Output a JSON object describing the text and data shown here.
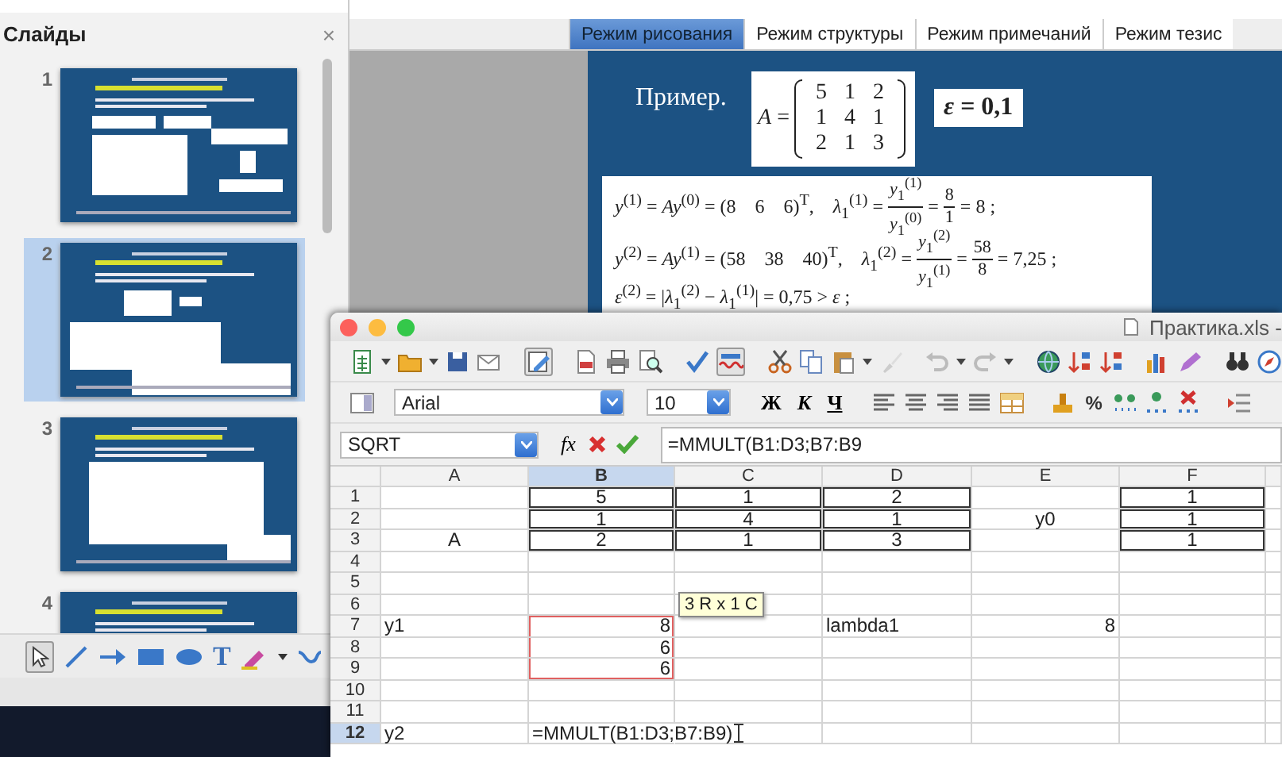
{
  "slides_panel": {
    "title": "Слайды",
    "close": "×",
    "slides": [
      {
        "number": "1",
        "selected": false
      },
      {
        "number": "2",
        "selected": true
      },
      {
        "number": "3",
        "selected": false
      },
      {
        "number": "4",
        "selected": false
      }
    ]
  },
  "drawing_toolbar": {
    "text_tool": "T"
  },
  "view_tabs": [
    {
      "label": "Режим рисования",
      "selected": true
    },
    {
      "label": "Режим структуры",
      "selected": false
    },
    {
      "label": "Режим примечаний",
      "selected": false
    },
    {
      "label": "Режим тезис",
      "selected": false
    }
  ],
  "slide": {
    "example_label": "Пример.",
    "matrix": {
      "label": "*A* =",
      "rows": [
        [
          "5",
          "1",
          "2"
        ],
        [
          "1",
          "4",
          "1"
        ],
        [
          "2",
          "1",
          "3"
        ]
      ]
    },
    "epsilon": "*ε* = 0,1",
    "formula_lines": [
      [
        {
          "kind": "text",
          "text": "*y*$^{(1)}$ = *Ay*$^{(0)}$ = (8    6    6)$^{T}$,    *λ*$_{1}$$^{(1)}$ = "
        },
        {
          "kind": "frac",
          "num": "*y*$_{1}$$^{(1)}$",
          "den": "*y*$_{1}$$^{(0)}$"
        },
        {
          "kind": "text",
          "text": " = "
        },
        {
          "kind": "frac",
          "num": "8",
          "den": "1"
        },
        {
          "kind": "text",
          "text": " = 8 ;"
        }
      ],
      [
        {
          "kind": "text",
          "text": "*y*$^{(2)}$ = *Ay*$^{(1)}$ = (58    38    40)$^{T}$,    *λ*$_{1}$$^{(2)}$ = "
        },
        {
          "kind": "frac",
          "num": "*y*$_{1}$$^{(2)}$",
          "den": "*y*$_{1}$$^{(1)}$"
        },
        {
          "kind": "text",
          "text": " = "
        },
        {
          "kind": "frac",
          "num": "58",
          "den": "8"
        },
        {
          "kind": "text",
          "text": " = 7,25 ;"
        }
      ],
      [
        {
          "kind": "text",
          "text": "*ε*$^{(2)}$ = |*λ*$_{1}$$^{(2)}$ − *λ*$_{1}$$^{(1)}$| = 0,75 > *ε* ;"
        }
      ]
    ]
  },
  "calc": {
    "title": "Практика.xls -",
    "font_name": "Arial",
    "font_size": "10",
    "format_buttons": [
      "Ж",
      "К",
      "Ч"
    ],
    "percent": "%",
    "name_box": "SQRT",
    "function_button": "fx",
    "formula": "=MMULT(B1:D3;B7:B9",
    "columns": [
      {
        "label": "A",
        "selected": false
      },
      {
        "label": "B",
        "selected": true
      },
      {
        "label": "C",
        "selected": false
      },
      {
        "label": "D",
        "selected": false
      },
      {
        "label": "E",
        "selected": false
      },
      {
        "label": "F",
        "selected": false
      }
    ],
    "rows": [
      {
        "header": "1",
        "selected": false,
        "cells": [
          null,
          {
            "text": "5",
            "kind": "centered",
            "selected": false,
            "boxed": true
          },
          {
            "text": "1",
            "kind": "centered",
            "selected": false,
            "boxed": true
          },
          {
            "text": "2",
            "kind": "centered",
            "selected": false,
            "boxed": true
          },
          null,
          {
            "text": "1",
            "kind": "centered",
            "selected": false,
            "boxed": true
          }
        ]
      },
      {
        "header": "2",
        "selected": false,
        "cells": [
          null,
          {
            "text": "1",
            "kind": "centered",
            "selected": false,
            "boxed": true
          },
          {
            "text": "4",
            "kind": "centered",
            "selected": false,
            "boxed": true
          },
          {
            "text": "1",
            "kind": "centered",
            "selected": false,
            "boxed": true
          },
          {
            "text": "y0",
            "kind": "centered",
            "selected": false,
            "boxed": false
          },
          {
            "text": "1",
            "kind": "centered",
            "selected": false,
            "boxed": true
          }
        ]
      },
      {
        "header": "3",
        "selected": false,
        "cells": [
          {
            "text": "A",
            "kind": "centered",
            "selected": false,
            "boxed": false
          },
          {
            "text": "2",
            "kind": "centered",
            "selected": false,
            "boxed": true
          },
          {
            "text": "1",
            "kind": "centered",
            "selected": false,
            "boxed": true
          },
          {
            "text": "3",
            "kind": "centered",
            "selected": false,
            "boxed": true
          },
          null,
          {
            "text": "1",
            "kind": "centered",
            "selected": false,
            "boxed": true
          }
        ]
      },
      {
        "header": "4",
        "selected": false,
        "cells": []
      },
      {
        "header": "5",
        "selected": false,
        "cells": []
      },
      {
        "header": "6",
        "selected": false,
        "cells": []
      },
      {
        "header": "7",
        "selected": false,
        "cells": [
          {
            "text": "y1",
            "kind": "text",
            "selected": false,
            "boxed": false
          },
          {
            "text": "8",
            "kind": "number",
            "selected": true,
            "boxed": false
          },
          null,
          {
            "text": "lambda1",
            "kind": "text",
            "selected": false,
            "boxed": false
          },
          {
            "text": "8",
            "kind": "number",
            "selected": false,
            "boxed": false
          },
          null
        ]
      },
      {
        "header": "8",
        "selected": false,
        "cells": [
          null,
          {
            "text": "6",
            "kind": "number",
            "selected": true,
            "boxed": false
          }
        ]
      },
      {
        "header": "9",
        "selected": false,
        "cells": [
          null,
          {
            "text": "6",
            "kind": "number",
            "selected": true,
            "boxed": false
          }
        ]
      },
      {
        "header": "10",
        "selected": false,
        "cells": []
      },
      {
        "header": "11",
        "selected": false,
        "cells": []
      },
      {
        "header": "12",
        "selected": true,
        "cells": [
          {
            "text": "y2",
            "kind": "text",
            "selected": false,
            "boxed": false
          },
          {
            "text": "=MMULT(B1:D3;B7:B9)",
            "kind": "editing",
            "selected": false,
            "boxed": false
          }
        ]
      }
    ],
    "tooltip": "3 R x 1 C"
  }
}
